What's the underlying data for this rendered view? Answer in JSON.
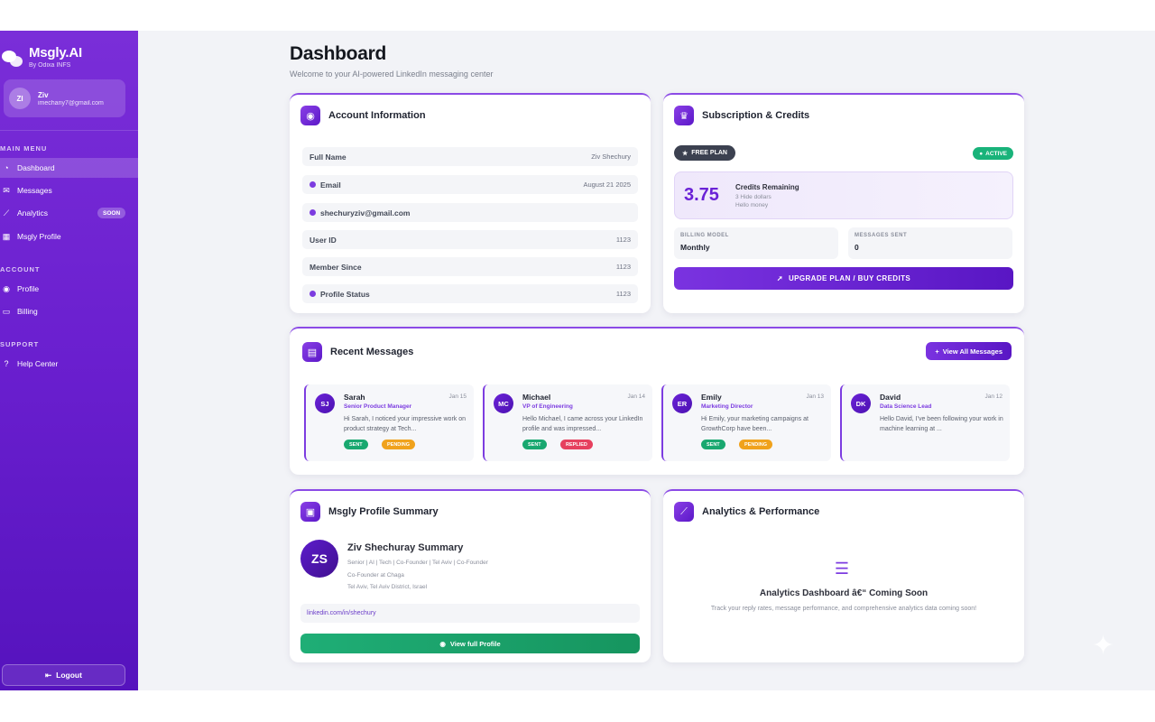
{
  "brand": {
    "name": "Msgly.AI",
    "sub": "By Odixa INFS"
  },
  "user": {
    "initials": "ZI",
    "name": "Ziv",
    "email": "imechany7@gmail.com"
  },
  "sidebar": {
    "main_title": "MAIN MENU",
    "main_items": [
      {
        "label": "Dashboard",
        "icon": "dashboard-icon"
      },
      {
        "label": "Messages",
        "icon": "mail-icon"
      },
      {
        "label": "Analytics",
        "icon": "chart-icon",
        "badge": "SOON"
      },
      {
        "label": "Msgly Profile",
        "icon": "profile-card-icon"
      }
    ],
    "account_title": "ACCOUNT",
    "account_items": [
      {
        "label": "Profile",
        "icon": "user-icon"
      },
      {
        "label": "Billing",
        "icon": "credit-card-icon"
      }
    ],
    "support_title": "SUPPORT",
    "support_items": [
      {
        "label": "Help Center",
        "icon": "help-icon"
      }
    ],
    "logout_label": "Logout"
  },
  "header": {
    "title": "Dashboard",
    "subtitle": "Welcome to your AI-powered LinkedIn messaging center"
  },
  "account_card": {
    "title": "Account Information",
    "rows": [
      {
        "label": "Full Name",
        "value": "Ziv Shechury"
      },
      {
        "label": "Email",
        "value": "August 21 2025"
      },
      {
        "label": "shechuryziv@gmail.com",
        "value": ""
      },
      {
        "label": "User ID",
        "value": "1123"
      },
      {
        "label": "Member Since",
        "value": "1123"
      },
      {
        "label": "Profile Status",
        "value": "1123"
      }
    ]
  },
  "subscription_card": {
    "title": "Subscription & Credits",
    "plan": "FREE PLAN",
    "status": "ACTIVE",
    "credits": "3.75",
    "credits_title": "Credits Remaining",
    "credits_line1": "3 Hide dollars",
    "credits_line2": "Hello money",
    "billing_label": "BILLING MODEL",
    "billing_value": "Monthly",
    "messages_label": "MESSAGES SENT",
    "messages_value": "0",
    "upgrade_label": "UPGRADE PLAN / BUY CREDITS"
  },
  "recent_messages": {
    "title": "Recent Messages",
    "view_all": "View All Messages",
    "items": [
      {
        "initials": "SJ",
        "name": "Sarah",
        "date": "Jan 15",
        "role": "Senior Product Manager",
        "text": "Hi Sarah, I noticed your impressive work on product strategy at Tech...",
        "tags": [
          {
            "label": "SENT",
            "color": "green"
          },
          {
            "label": "PENDING",
            "color": "amber"
          }
        ]
      },
      {
        "initials": "MC",
        "name": "Michael",
        "date": "Jan 14",
        "role": "VP of Engineering",
        "text": "Hello Michael, I came across your LinkedIn profile and was impressed...",
        "tags": [
          {
            "label": "SENT",
            "color": "green"
          },
          {
            "label": "REPLIED",
            "color": "red"
          }
        ]
      },
      {
        "initials": "ER",
        "name": "Emily",
        "date": "Jan 13",
        "role": "Marketing Director",
        "text": "Hi Emily, your marketing campaigns at GrowthCorp have been...",
        "tags": [
          {
            "label": "SENT",
            "color": "green"
          },
          {
            "label": "PENDING",
            "color": "amber"
          }
        ]
      },
      {
        "initials": "DK",
        "name": "David",
        "date": "Jan 12",
        "role": "Data Science Lead",
        "text": "Hello David, I've been following your work in machine learning at ...",
        "tags": []
      }
    ]
  },
  "profile_card": {
    "title": "Msgly Profile Summary",
    "initials": "ZS",
    "name": "Ziv Shechuray Summary",
    "line1": "Senior | AI | Tech | Co-Founder | Tel Aviv | Co-Founder",
    "line2": "Co-Founder at Chaga",
    "line3": "Tel Aviv, Tel Aviv District, Israel",
    "link": "linkedin.com/in/shechury",
    "button": "View full Profile"
  },
  "analytics_card": {
    "title": "Analytics & Performance",
    "heading": "Analytics Dashboard â€“ Coming Soon",
    "desc": "Track your reply rates, message performance, and comprehensive analytics data coming soon!"
  },
  "colors": {
    "brand": "#6a1fcf",
    "accent": "#7c3ce0",
    "success": "#19a870",
    "warning": "#f0a21c",
    "danger": "#e6405e"
  }
}
